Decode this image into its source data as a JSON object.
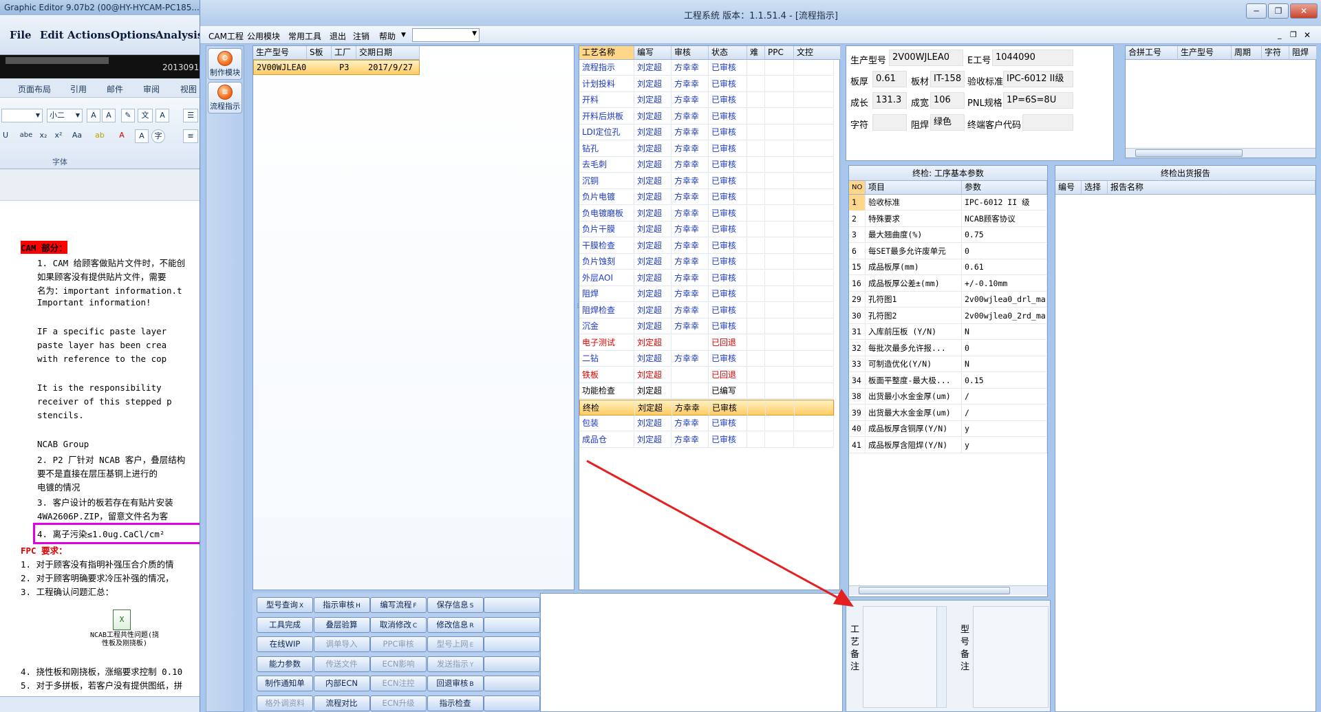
{
  "background_window": {
    "title": "Graphic Editor 9.07b2 (00@HY-HYCAM-PC185...",
    "menu": [
      "File",
      "Edit",
      "Actions",
      "Options",
      "Analysis"
    ],
    "dark_bar_text": "20130911",
    "ribbon_tabs": [
      "页面布局",
      "引用",
      "邮件",
      "审阅",
      "视图"
    ],
    "font_size_value": "小二",
    "font_group_label": "字体",
    "doc_lines": [
      {
        "text": "CAM 部分：",
        "style": "heading"
      },
      {
        "text": "1.  CAM 给顾客做贴片文件时，不能创",
        "style": "normal"
      },
      {
        "text": "    如果顾客没有提供贴片文件，需要",
        "style": "normal"
      },
      {
        "text": "    名为：important information.t",
        "style": "normal"
      },
      {
        "text": "    Important information!",
        "style": "normal"
      },
      {
        "text": "",
        "style": "normal"
      },
      {
        "text": "    IF a specific paste layer",
        "style": "normal"
      },
      {
        "text": "    paste layer has been crea",
        "style": "normal"
      },
      {
        "text": "    with reference to the cop",
        "style": "normal"
      },
      {
        "text": "",
        "style": "normal"
      },
      {
        "text": "    It is the responsibility",
        "style": "normal"
      },
      {
        "text": "    receiver of this stepped p",
        "style": "normal"
      },
      {
        "text": "    stencils.",
        "style": "normal"
      },
      {
        "text": "",
        "style": "normal"
      },
      {
        "text": "    NCAB Group",
        "style": "normal"
      },
      {
        "text": "2.  P2 厂针对 NCAB 客户，叠层结构",
        "style": "normal"
      },
      {
        "text": "    要不是直接在层压基铜上进行的",
        "style": "normal"
      },
      {
        "text": "    电镀的情况",
        "style": "normal"
      },
      {
        "text": "3.  客户设计的板若存在有贴片安装",
        "style": "normal"
      },
      {
        "text": "    4WA2606P.ZIP，留意文件名为客",
        "style": "normal"
      },
      {
        "text": "4.  离子污染≤1.0ug.CaCl/cm²",
        "style": "boxed"
      },
      {
        "text": "FPC 要求：",
        "style": "red"
      },
      {
        "text": "1.  对于顾客没有指明补强压合介质的情",
        "style": "normal"
      },
      {
        "text": "2.  对于顾客明确要求冷压补强的情况，",
        "style": "normal"
      },
      {
        "text": "3.  工程确认问题汇总：",
        "style": "normal"
      }
    ],
    "attachment_label": "NCAB工程共性问题(挠性板及刚挠板)",
    "doc_tail": [
      "4.  挠性板和刚挠板，涨缩要求控制 0.10",
      "5.  对于多拼板，若客户没有提供图纸，拼"
    ]
  },
  "window": {
    "title": "工程系统  版本：1.1.51.4 - [流程指示]",
    "menu": [
      "CAM工程",
      "公用模块",
      "常用工具",
      "退出",
      "注销",
      "帮助"
    ],
    "combo_value": ""
  },
  "strip": {
    "buttons": [
      {
        "label": "制作模块",
        "icon": "production-module-icon"
      },
      {
        "label": "流程指示",
        "icon": "flow-instruction-icon"
      }
    ]
  },
  "product_list": {
    "headers": [
      "生产型号",
      "S板",
      "工厂",
      "交期日期"
    ],
    "rows": [
      {
        "model": "2V00WJLEA0",
        "s": "",
        "factory": "P3",
        "date": "2017/9/27",
        "selected": true
      }
    ]
  },
  "process_list": {
    "headers": [
      "工艺名称",
      "编写",
      "审核",
      "状态",
      "难",
      "PPC",
      "文控"
    ],
    "rows": [
      {
        "name": "流程指示",
        "writer": "刘定超",
        "reviewer": "方幸幸",
        "status": "已审核",
        "color": "blue"
      },
      {
        "name": "计划投料",
        "writer": "刘定超",
        "reviewer": "方幸幸",
        "status": "已审核",
        "color": "blue"
      },
      {
        "name": "开料",
        "writer": "刘定超",
        "reviewer": "方幸幸",
        "status": "已审核",
        "color": "blue"
      },
      {
        "name": "开料后烘板",
        "writer": "刘定超",
        "reviewer": "方幸幸",
        "status": "已审核",
        "color": "blue"
      },
      {
        "name": "LDI定位孔",
        "writer": "刘定超",
        "reviewer": "方幸幸",
        "status": "已审核",
        "color": "blue"
      },
      {
        "name": "钻孔",
        "writer": "刘定超",
        "reviewer": "方幸幸",
        "status": "已审核",
        "color": "blue"
      },
      {
        "name": "去毛刺",
        "writer": "刘定超",
        "reviewer": "方幸幸",
        "status": "已审核",
        "color": "blue"
      },
      {
        "name": "沉铜",
        "writer": "刘定超",
        "reviewer": "方幸幸",
        "status": "已审核",
        "color": "blue"
      },
      {
        "name": "负片电镀",
        "writer": "刘定超",
        "reviewer": "方幸幸",
        "status": "已审核",
        "color": "blue"
      },
      {
        "name": "负电镀磨板",
        "writer": "刘定超",
        "reviewer": "方幸幸",
        "status": "已审核",
        "color": "blue"
      },
      {
        "name": "负片干膜",
        "writer": "刘定超",
        "reviewer": "方幸幸",
        "status": "已审核",
        "color": "blue"
      },
      {
        "name": "干膜检查",
        "writer": "刘定超",
        "reviewer": "方幸幸",
        "status": "已审核",
        "color": "blue"
      },
      {
        "name": "负片蚀刻",
        "writer": "刘定超",
        "reviewer": "方幸幸",
        "status": "已审核",
        "color": "blue"
      },
      {
        "name": "外层AOI",
        "writer": "刘定超",
        "reviewer": "方幸幸",
        "status": "已审核",
        "color": "blue"
      },
      {
        "name": "阻焊",
        "writer": "刘定超",
        "reviewer": "方幸幸",
        "status": "已审核",
        "color": "blue"
      },
      {
        "name": "阻焊检查",
        "writer": "刘定超",
        "reviewer": "方幸幸",
        "status": "已审核",
        "color": "blue"
      },
      {
        "name": "沉金",
        "writer": "刘定超",
        "reviewer": "方幸幸",
        "status": "已审核",
        "color": "blue"
      },
      {
        "name": "电子测试",
        "writer": "刘定超",
        "reviewer": "",
        "status": "已回退",
        "color": "red"
      },
      {
        "name": "二钻",
        "writer": "刘定超",
        "reviewer": "方幸幸",
        "status": "已审核",
        "color": "blue"
      },
      {
        "name": "铁板",
        "writer": "刘定超",
        "reviewer": "",
        "status": "已回退",
        "color": "red"
      },
      {
        "name": "功能检查",
        "writer": "刘定超",
        "reviewer": "",
        "status": "已编写",
        "color": "black"
      },
      {
        "name": "终检",
        "writer": "刘定超",
        "reviewer": "方幸幸",
        "status": "已审核",
        "color": "black",
        "selected": true
      },
      {
        "name": "包装",
        "writer": "刘定超",
        "reviewer": "方幸幸",
        "status": "已审核",
        "color": "blue"
      },
      {
        "name": "成品仓",
        "writer": "刘定超",
        "reviewer": "方幸幸",
        "status": "已审核",
        "color": "blue"
      }
    ]
  },
  "info": {
    "model_label": "生产型号",
    "model_value": "2V00WJLEA0",
    "eno_label": "E工号",
    "eno_value": "1044090",
    "thick_label": "板厚",
    "thick_value": "0.61",
    "material_label": "板材",
    "material_value": "IT-158",
    "standard_label": "验收标准",
    "standard_value": "IPC-6012 II级",
    "length_label": "成长",
    "length_value": "131.3",
    "width_label": "成宽",
    "width_value": "106",
    "pnl_label": "PNL规格",
    "pnl_value": "1P=6S=8U",
    "char_label": "字符",
    "char_value": "",
    "mask_label": "阻焊",
    "mask_value": "绿色",
    "customer_label": "终端客户代码",
    "customer_value": ""
  },
  "merge": {
    "headers": [
      "合拼工号",
      "生产型号",
      "周期",
      "字符",
      "阻焊"
    ]
  },
  "param": {
    "title": "终检: 工序基本参数",
    "headers": [
      "NO",
      "项目",
      "参数"
    ],
    "rows": [
      {
        "no": "1",
        "item": "验收标准",
        "value": "IPC-6012 II 级"
      },
      {
        "no": "2",
        "item": "特殊要求",
        "value": "NCAB顾客协议"
      },
      {
        "no": "3",
        "item": "最大翘曲度(%)",
        "value": "0.75"
      },
      {
        "no": "6",
        "item": "每SET最多允许废单元",
        "value": "0"
      },
      {
        "no": "15",
        "item": "成品板厚(mm)",
        "value": "0.61"
      },
      {
        "no": "16",
        "item": "成品板厚公差±(mm)",
        "value": "+/-0.10mm"
      },
      {
        "no": "29",
        "item": "孔符图1",
        "value": "2v00wjlea0_drl_ma"
      },
      {
        "no": "30",
        "item": "孔符图2",
        "value": "2v00wjlea0_2rd_ma"
      },
      {
        "no": "31",
        "item": "入库前压板 (Y/N)",
        "value": "N"
      },
      {
        "no": "32",
        "item": "每批次最多允许报...",
        "value": "0"
      },
      {
        "no": "33",
        "item": "可制造优化(Y/N)",
        "value": "N"
      },
      {
        "no": "34",
        "item": "板面平整度-最大极...",
        "value": "0.15"
      },
      {
        "no": "38",
        "item": "出货最小水金金厚(um)",
        "value": "/"
      },
      {
        "no": "39",
        "item": "出货最大水金金厚(um)",
        "value": "/"
      },
      {
        "no": "40",
        "item": "成品板厚含铜厚(Y/N)",
        "value": "y"
      },
      {
        "no": "41",
        "item": "成品板厚含阻焊(Y/N)",
        "value": "y"
      }
    ]
  },
  "report": {
    "title": "终检出货报告",
    "headers": [
      "编号",
      "选择",
      "报告名称"
    ]
  },
  "notes": {
    "process_label": "工艺备注",
    "model_label": "型号备注"
  },
  "buttons": [
    [
      {
        "t": "型号查询",
        "k": "X",
        "d": false
      },
      {
        "t": "指示审核",
        "k": "H",
        "d": false
      },
      {
        "t": "编写流程",
        "k": "F",
        "d": false
      },
      {
        "t": "保存信息",
        "k": "S",
        "d": false
      },
      {
        "t": "",
        "k": "",
        "d": false
      }
    ],
    [
      {
        "t": "工具完成",
        "k": "",
        "d": false
      },
      {
        "t": "叠层验算",
        "k": "",
        "d": false
      },
      {
        "t": "取消修改",
        "k": "C",
        "d": false
      },
      {
        "t": "修改信息",
        "k": "R",
        "d": false
      },
      {
        "t": "",
        "k": "",
        "d": false
      }
    ],
    [
      {
        "t": "在线WIP",
        "k": "",
        "d": false
      },
      {
        "t": "调单导入",
        "k": "",
        "d": true
      },
      {
        "t": "PPC审核",
        "k": "",
        "d": true
      },
      {
        "t": "型号上网",
        "k": "E",
        "d": true
      },
      {
        "t": "",
        "k": "",
        "d": false
      }
    ],
    [
      {
        "t": "能力参数",
        "k": "",
        "d": false
      },
      {
        "t": "传送文件",
        "k": "",
        "d": true
      },
      {
        "t": "ECN影响",
        "k": "",
        "d": true
      },
      {
        "t": "发送指示",
        "k": "Y",
        "d": true
      },
      {
        "t": "",
        "k": "",
        "d": false
      }
    ],
    [
      {
        "t": "制作通知单",
        "k": "",
        "d": false
      },
      {
        "t": "内部ECN",
        "k": "",
        "d": false
      },
      {
        "t": "ECN注控",
        "k": "",
        "d": true
      },
      {
        "t": "回退审核",
        "k": "B",
        "d": false
      },
      {
        "t": "",
        "k": "",
        "d": false
      }
    ],
    [
      {
        "t": "格外调资料",
        "k": "",
        "d": true
      },
      {
        "t": "流程对比",
        "k": "",
        "d": false
      },
      {
        "t": "ECN升级",
        "k": "",
        "d": true
      },
      {
        "t": "指示检查",
        "k": "",
        "d": false
      },
      {
        "t": "",
        "k": "",
        "d": false
      }
    ]
  ],
  "colors": {
    "arrow": "#e52020",
    "selected": "#ffcc66",
    "magenta_box": "#e000e0"
  }
}
